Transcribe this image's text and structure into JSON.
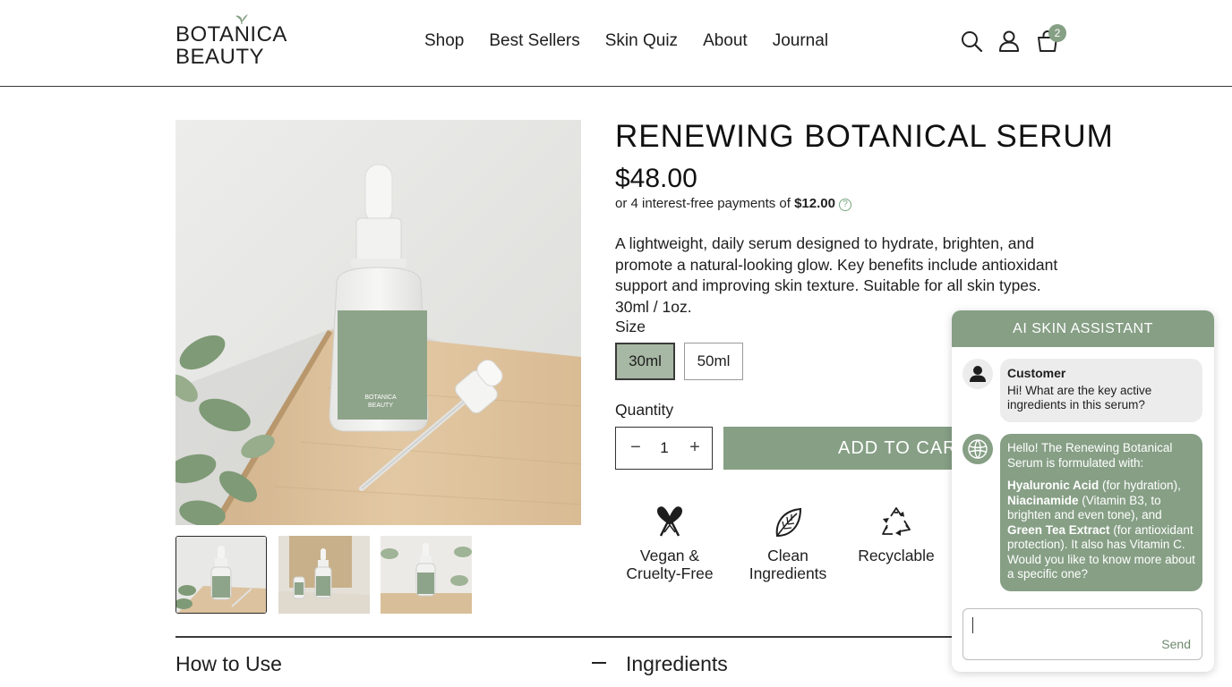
{
  "header": {
    "logo_line1": "BOTANICA",
    "logo_line2": "BEAUTY",
    "nav": [
      "Shop",
      "Best Sellers",
      "Skin Quiz",
      "About",
      "Journal"
    ],
    "cart_count": "2",
    "icons": [
      "search-icon",
      "user-icon",
      "cart-icon"
    ]
  },
  "product": {
    "title": "RENEWING BOTANICAL SERUM",
    "price": "$48.00",
    "installments_prefix": "or 4 interest-free payments of ",
    "installments_amount": "$12.00",
    "installments_help": "?",
    "description": "A lightweight, daily serum designed to hydrate, brighten, and promote a natural-looking glow. Key benefits include antioxidant support and improving skin texture. Suitable for all skin types. 30ml / 1oz.",
    "bottle_label_line1": "BOTANICA",
    "bottle_label_line2": "BEAUTY",
    "size_label": "Size",
    "sizes": [
      {
        "label": "30ml",
        "selected": true
      },
      {
        "label": "50ml",
        "selected": false
      }
    ],
    "quantity_label": "Quantity",
    "quantity_minus": "−",
    "quantity_value": "1",
    "quantity_plus": "+",
    "add_to_cart": "ADD TO CART",
    "features": [
      {
        "icon": "heart-ribbon-icon",
        "line1": "Vegan &",
        "line2": "Cruelty-Free"
      },
      {
        "icon": "leaf-icon",
        "line1": "Clean",
        "line2": "Ingredients"
      },
      {
        "icon": "recycle-icon",
        "line1": "Recyclable",
        "line2": ""
      }
    ],
    "thumbnails": 3,
    "selected_thumbnail": 1
  },
  "accordion": {
    "how_to_use": "How to Use",
    "ingredients": "Ingredients"
  },
  "chat": {
    "title": "AI SKIN ASSISTANT",
    "user_name": "Customer",
    "user_message": "Hi! What are the key active ingredients in this serum?",
    "bot_intro": "Hello! The Renewing Botanical Serum is formulated with:",
    "bot_ing1": "Hyaluronic Acid",
    "bot_ing1_note": " (for hydration), ",
    "bot_ing2": "Niacinamide",
    "bot_ing2_note": " (Vitamin B3, to brighten and even tone), and ",
    "bot_ing3": "Green Tea Extract",
    "bot_ing3_note": " (for antioxidant protection). It also has Vitamin C. Would you like to know more about a specific one?",
    "input_value": "",
    "send_label": "Send"
  },
  "colors": {
    "accent_sage": "#869f85",
    "selected_size_bg": "#a7b8a4",
    "text": "#1e1e1e"
  }
}
